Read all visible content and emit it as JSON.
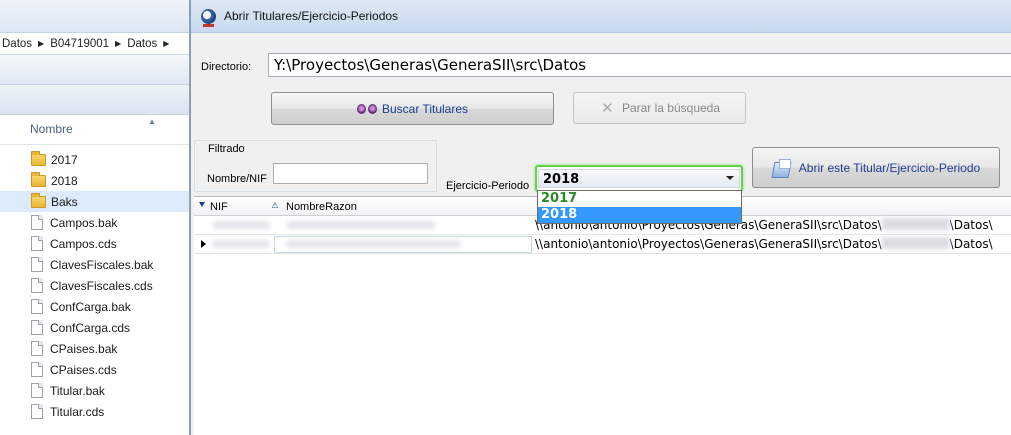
{
  "explorer": {
    "breadcrumb": [
      "Datos",
      "B04719001",
      "Datos"
    ],
    "column_header": "Nombre",
    "items": [
      {
        "name": "2017",
        "type": "folder"
      },
      {
        "name": "2018",
        "type": "folder"
      },
      {
        "name": "Baks",
        "type": "folder",
        "selected": true
      },
      {
        "name": "Campos.bak",
        "type": "file"
      },
      {
        "name": "Campos.cds",
        "type": "file"
      },
      {
        "name": "ClavesFiscales.bak",
        "type": "file"
      },
      {
        "name": "ClavesFiscales.cds",
        "type": "file"
      },
      {
        "name": "ConfCarga.bak",
        "type": "file"
      },
      {
        "name": "ConfCarga.cds",
        "type": "file"
      },
      {
        "name": "CPaises.bak",
        "type": "file"
      },
      {
        "name": "CPaises.cds",
        "type": "file"
      },
      {
        "name": "Titular.bak",
        "type": "file"
      },
      {
        "name": "Titular.cds",
        "type": "file"
      }
    ]
  },
  "dialog": {
    "title": "Abrir Titulares/Ejercicio-Periodos",
    "directorio_label": "Directorio:",
    "directorio_value": "Y:\\Proyectos\\Generas\\GeneraSII\\src\\Datos",
    "buscar_label": "Buscar Titulares",
    "parar_label": "Parar la búsqueda",
    "filtrado_title": "Filtrado",
    "nombre_label": "Nombre/NIF",
    "nombre_value": "",
    "ejercicio_label": "Ejercicio-Periodo",
    "ejercicio_selected": "2018",
    "ejercicio_options": [
      "2017",
      "2018"
    ],
    "abrir_label": "Abrir este Titular/Ejercicio-Periodo"
  },
  "grid": {
    "columns": [
      "NIF",
      "NombreRazon"
    ],
    "rows": [
      {
        "path_prefix": "\\\\antonio\\antonio\\Proyectos\\Generas\\GeneraSII\\src\\Datos\\",
        "path_suffix": "\\Datos\\",
        "current": false
      },
      {
        "path_prefix": "\\\\antonio\\antonio\\Proyectos\\Generas\\GeneraSII\\src\\Datos\\",
        "path_suffix": "\\Datos\\",
        "current": true
      }
    ]
  },
  "colors": {
    "accent_text": "#1b3f8f",
    "combo_focus": "#62d34c",
    "dropdown_selected": "#3399ff"
  }
}
